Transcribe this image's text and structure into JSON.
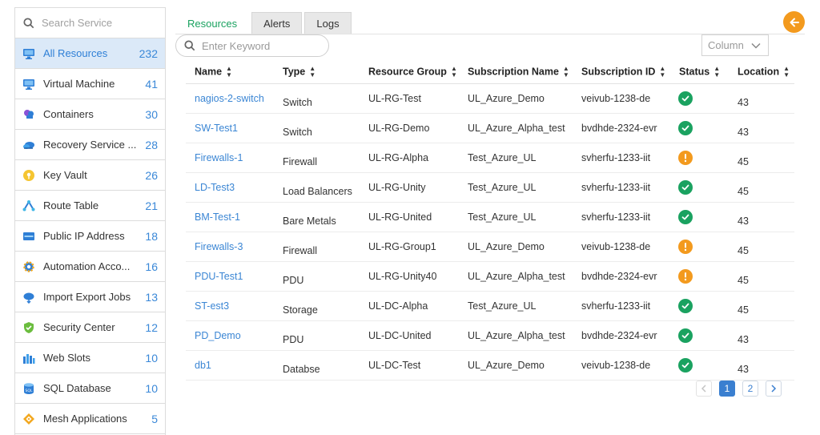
{
  "sidebar": {
    "search_placeholder": "Search Service",
    "items": [
      {
        "label": "All Resources",
        "count": "232",
        "icon": "monitor-icon"
      },
      {
        "label": "Virtual Machine",
        "count": "41",
        "icon": "monitor-icon"
      },
      {
        "label": "Containers",
        "count": "30",
        "icon": "containers-cloud-icon"
      },
      {
        "label": "Recovery Service ...",
        "count": "28",
        "icon": "recovery-cloud-icon"
      },
      {
        "label": "Key Vault",
        "count": "26",
        "icon": "key-vault-icon"
      },
      {
        "label": "Route Table",
        "count": "21",
        "icon": "route-table-icon"
      },
      {
        "label": "Public IP Address",
        "count": "18",
        "icon": "public-ip-icon"
      },
      {
        "label": "Automation Acco...",
        "count": "16",
        "icon": "automation-gear-icon"
      },
      {
        "label": "Import Export Jobs",
        "count": "13",
        "icon": "import-export-cloud-icon"
      },
      {
        "label": "Security Center",
        "count": "12",
        "icon": "security-shield-icon"
      },
      {
        "label": "Web Slots",
        "count": "10",
        "icon": "web-slots-icon"
      },
      {
        "label": "SQL Database",
        "count": "10",
        "icon": "sql-database-icon"
      },
      {
        "label": "Mesh Applications",
        "count": "5",
        "icon": "mesh-diamond-icon"
      }
    ]
  },
  "tabs": [
    "Resources",
    "Alerts",
    "Logs"
  ],
  "keyword_placeholder": "Enter Keyword",
  "column_select": "Column",
  "table": {
    "headers": [
      "Name",
      "Type",
      "Resource Group",
      "Subscription Name",
      "Subscription ID",
      "Status",
      "Location"
    ],
    "rows": [
      {
        "name": "nagios-2-switch",
        "type": "Switch",
        "group": "UL-RG-Test",
        "sub_name": "UL_Azure_Demo",
        "sub_id": "veivub-1238-de",
        "status": "ok",
        "location": "43"
      },
      {
        "name": "SW-Test1",
        "type": "Switch",
        "group": "UL-RG-Demo",
        "sub_name": "UL_Azure_Alpha_test",
        "sub_id": "bvdhde-2324-evr",
        "status": "ok",
        "location": "43"
      },
      {
        "name": "Firewalls-1",
        "type": "Firewall",
        "group": "UL-RG-Alpha",
        "sub_name": "Test_Azure_UL",
        "sub_id": "svherfu-1233-iit",
        "status": "warning",
        "location": "45"
      },
      {
        "name": "LD-Test3",
        "type": "Load Balancers",
        "group": "UL-RG-Unity",
        "sub_name": "Test_Azure_UL",
        "sub_id": "svherfu-1233-iit",
        "status": "ok",
        "location": "45"
      },
      {
        "name": "BM-Test-1",
        "type": "Bare Metals",
        "group": "UL-RG-United",
        "sub_name": "Test_Azure_UL",
        "sub_id": "svherfu-1233-iit",
        "status": "ok",
        "location": "43"
      },
      {
        "name": "Firewalls-3",
        "type": "Firewall",
        "group": "UL-RG-Group1",
        "sub_name": "UL_Azure_Demo",
        "sub_id": "veivub-1238-de",
        "status": "warning",
        "location": "45"
      },
      {
        "name": "PDU-Test1",
        "type": "PDU",
        "group": "UL-RG-Unity40",
        "sub_name": "UL_Azure_Alpha_test",
        "sub_id": "bvdhde-2324-evr",
        "status": "warning",
        "location": "45"
      },
      {
        "name": "ST-est3",
        "type": "Storage",
        "group": "UL-DC-Alpha",
        "sub_name": "Test_Azure_UL",
        "sub_id": "svherfu-1233-iit",
        "status": "ok",
        "location": "45"
      },
      {
        "name": "PD_Demo",
        "type": "PDU",
        "group": "UL-DC-United",
        "sub_name": "UL_Azure_Alpha_test",
        "sub_id": "bvdhde-2324-evr",
        "status": "ok",
        "location": "43"
      },
      {
        "name": "db1",
        "type": "Databse",
        "group": "UL-DC-Test",
        "sub_name": "UL_Azure_Demo",
        "sub_id": "veivub-1238-de",
        "status": "ok",
        "location": "43"
      }
    ]
  },
  "pagination": {
    "pages": [
      "1",
      "2"
    ],
    "current": "1"
  },
  "colors": {
    "accent": "#3a88d8",
    "ok": "#1aa260",
    "warning": "#f39a1e",
    "active_tab": "#1aa260"
  }
}
